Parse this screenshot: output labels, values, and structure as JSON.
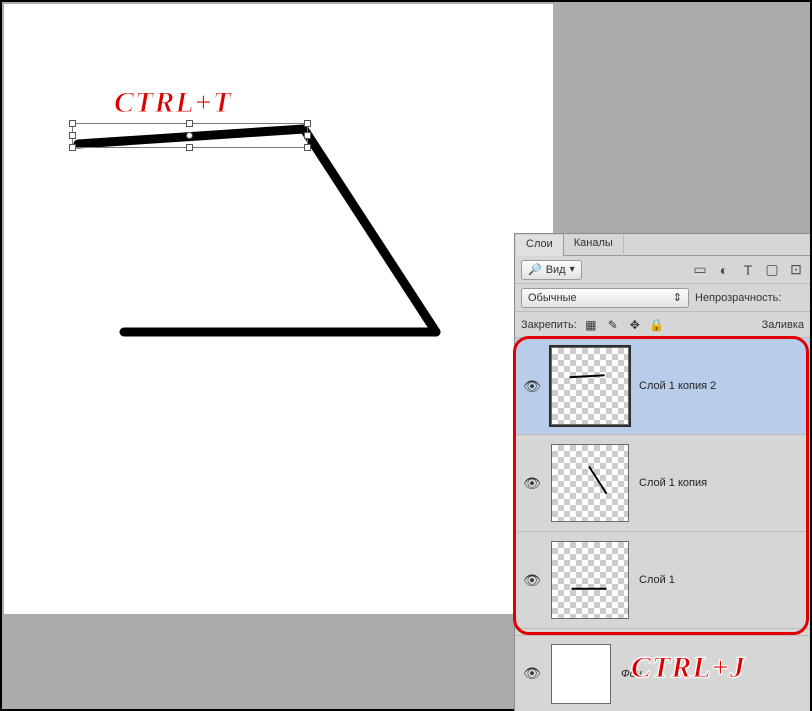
{
  "annotations": {
    "top": "CTRL+T",
    "bottom": "CTRL+J"
  },
  "panel": {
    "tabs": {
      "layers": "Слои",
      "channels": "Каналы"
    },
    "filter_row": {
      "kind_icon": "🔎",
      "kind_label": "Вид",
      "icons": [
        "image-icon",
        "adjust-icon",
        "type-icon",
        "shape-icon",
        "smart-icon"
      ]
    },
    "blend_row": {
      "mode": "Обычные",
      "opacity_label": "Непрозрачность:"
    },
    "lock_row": {
      "label": "Закрепить:",
      "fill_label": "Заливка"
    },
    "layers": [
      {
        "name": "Слой 1 копия 2",
        "selected": true,
        "thumb": "line-h"
      },
      {
        "name": "Слой 1 копия",
        "selected": false,
        "thumb": "line-diag"
      },
      {
        "name": "Слой 1",
        "selected": false,
        "thumb": "line-h2"
      }
    ],
    "background": {
      "name": "Фон"
    }
  }
}
